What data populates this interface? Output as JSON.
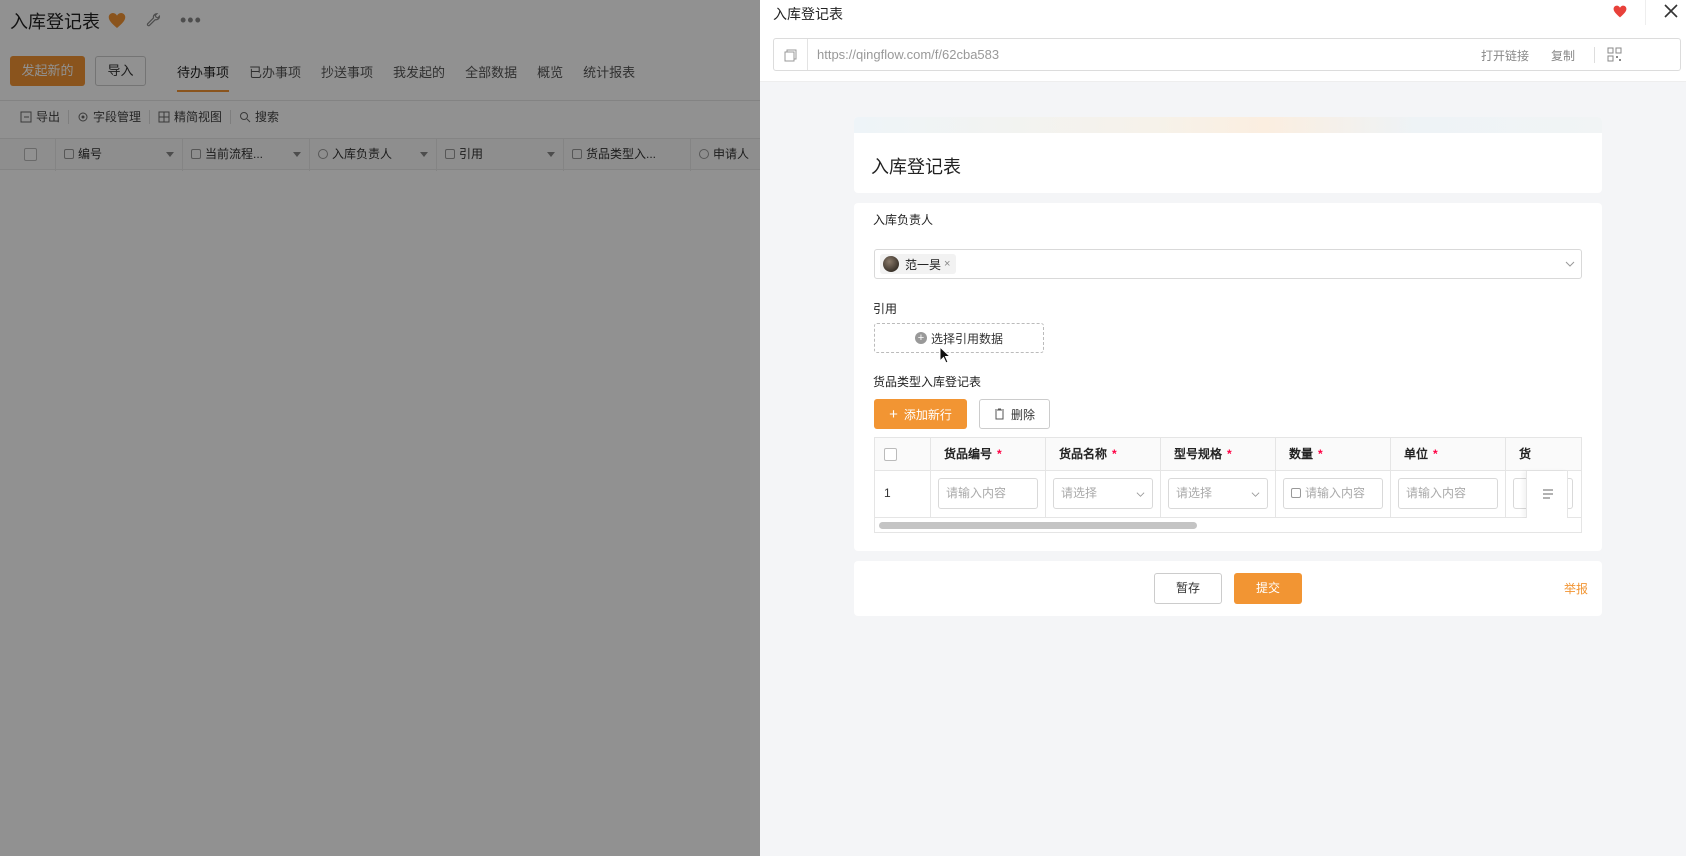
{
  "app": {
    "title": "入库登记表",
    "new_button": "发起新的",
    "import_button": "导入",
    "tabs": [
      "待办事项",
      "已办事项",
      "抄送事项",
      "我发起的",
      "全部数据",
      "概览",
      "统计报表"
    ],
    "toolbar": [
      "导出",
      "字段管理",
      "精简视图",
      "搜索"
    ],
    "columns": [
      "编号",
      "当前流程...",
      "入库负责人",
      "引用",
      "货品类型入...",
      "申请人"
    ]
  },
  "drawer": {
    "title": "入库登记表",
    "url": "https://qingflow.com/f/62cba583",
    "open_link": "打开链接",
    "copy": "复制",
    "form": {
      "title": "入库登记表",
      "owner_label": "入库负责人",
      "owner_value": "范一昊",
      "ref_label": "引用",
      "ref_button": "选择引用数据",
      "subtable_label": "货品类型入库登记表",
      "add_row": "添加新行",
      "delete": "删除",
      "subtable_columns": [
        "货品编号",
        "货品名称",
        "型号规格",
        "数量",
        "单位",
        "货"
      ],
      "row_number": "1",
      "placeholders": {
        "input": "请输入内容",
        "select": "请选择"
      }
    },
    "footer": {
      "save": "暂存",
      "submit": "提交",
      "report": "举报"
    }
  },
  "colors": {
    "accent": "#f29533",
    "heart": "#e8413a"
  }
}
